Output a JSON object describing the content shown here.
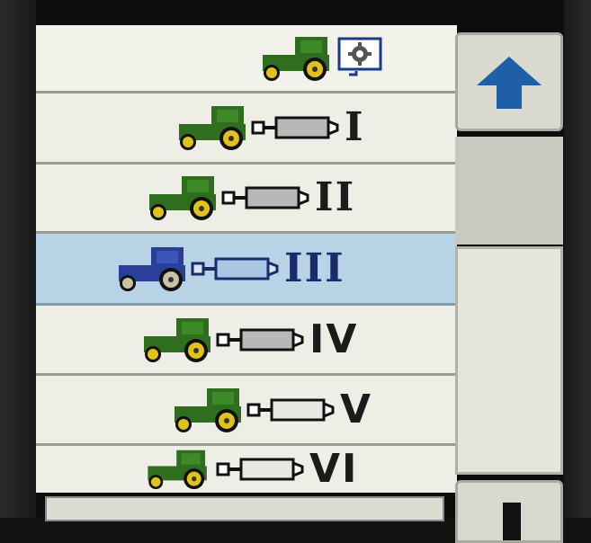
{
  "colors": {
    "tractor_body": "#2f6e1e",
    "tractor_wheel": "#e0c21a",
    "tractor_selected": "#2a3f9a",
    "cylinder_fill": "#b8b8b8",
    "selected_row": "#b9d3e6",
    "row_bg": "#efeee6"
  },
  "header": {
    "icon": "tractor-settings-icon"
  },
  "rows": [
    {
      "numeral": "I",
      "icon": "tractor-implement-icon",
      "selected": false
    },
    {
      "numeral": "II",
      "icon": "tractor-implement-icon",
      "selected": false
    },
    {
      "numeral": "III",
      "icon": "tractor-implement-icon",
      "selected": true
    },
    {
      "numeral": "IV",
      "icon": "tractor-implement-icon",
      "selected": false
    },
    {
      "numeral": "V",
      "icon": "tractor-implement-icon",
      "selected": false
    },
    {
      "numeral": "VI",
      "icon": "tractor-implement-icon",
      "selected": false
    }
  ],
  "scrollbar": {
    "up_icon": "arrow-up-icon",
    "down_icon": "arrow-down-icon"
  }
}
